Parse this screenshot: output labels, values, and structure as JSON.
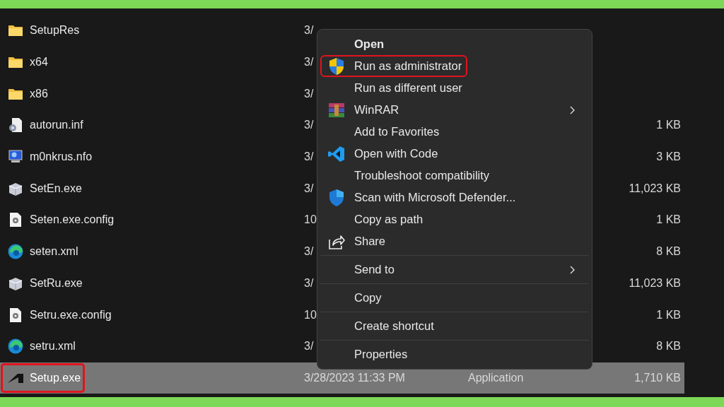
{
  "files": [
    {
      "name": "SetupRes",
      "kind": "folder",
      "date": "3/",
      "selected": false,
      "highlighted": false
    },
    {
      "name": "x64",
      "kind": "folder",
      "date": "3/",
      "selected": false,
      "highlighted": false
    },
    {
      "name": "x86",
      "kind": "folder",
      "date": "3/",
      "selected": false,
      "highlighted": false
    },
    {
      "name": "autorun.inf",
      "kind": "inf",
      "date": "3/",
      "size": "1 KB",
      "selected": false,
      "highlighted": false
    },
    {
      "name": "m0nkrus.nfo",
      "kind": "nfo",
      "date": "3/",
      "size": "3 KB",
      "selected": false,
      "highlighted": false
    },
    {
      "name": "SetEn.exe",
      "kind": "exe",
      "date": "3/",
      "size": "11,023 KB",
      "selected": false,
      "highlighted": false
    },
    {
      "name": "Seten.exe.config",
      "kind": "config",
      "date": "10",
      "size": "1 KB",
      "selected": false,
      "highlighted": false
    },
    {
      "name": "seten.xml",
      "kind": "xml",
      "date": "3/",
      "size": "8 KB",
      "selected": false,
      "highlighted": false
    },
    {
      "name": "SetRu.exe",
      "kind": "exe",
      "date": "3/",
      "size": "11,023 KB",
      "selected": false,
      "highlighted": false
    },
    {
      "name": "Setru.exe.config",
      "kind": "config",
      "date": "10",
      "size": "1 KB",
      "selected": false,
      "highlighted": false
    },
    {
      "name": "setru.xml",
      "kind": "xml",
      "date": "3/",
      "size": "8 KB",
      "selected": false,
      "highlighted": false
    },
    {
      "name": "Setup.exe",
      "kind": "app",
      "date": "3/28/2023 11:33 PM",
      "type": "Application",
      "size": "1,710 KB",
      "selected": true,
      "highlighted": true
    }
  ],
  "context_menu": {
    "groups": [
      [
        {
          "label": "Open",
          "kind": "plain",
          "default": true,
          "submenu": false,
          "highlighted": false
        },
        {
          "label": "Run as administrator",
          "kind": "uac",
          "default": false,
          "submenu": false,
          "highlighted": true
        },
        {
          "label": "Run as different user",
          "kind": "plain",
          "default": false,
          "submenu": false,
          "highlighted": false
        },
        {
          "label": "WinRAR",
          "kind": "archive",
          "default": false,
          "submenu": true,
          "highlighted": false
        },
        {
          "label": "Add to Favorites",
          "kind": "plain",
          "default": false,
          "submenu": false,
          "highlighted": false
        },
        {
          "label": "Open with Code",
          "kind": "code",
          "default": false,
          "submenu": false,
          "highlighted": false
        },
        {
          "label": "Troubleshoot compatibility",
          "kind": "plain",
          "default": false,
          "submenu": false,
          "highlighted": false
        },
        {
          "label": "Scan with Microsoft Defender...",
          "kind": "defender",
          "default": false,
          "submenu": false,
          "highlighted": false
        },
        {
          "label": "Copy as path",
          "kind": "plain",
          "default": false,
          "submenu": false,
          "highlighted": false
        },
        {
          "label": "Share",
          "kind": "share",
          "default": false,
          "submenu": false,
          "highlighted": false
        }
      ],
      [
        {
          "label": "Send to",
          "kind": "plain",
          "default": false,
          "submenu": true,
          "highlighted": false
        }
      ],
      [
        {
          "label": "Copy",
          "kind": "plain",
          "default": false,
          "submenu": false,
          "highlighted": false
        }
      ],
      [
        {
          "label": "Create shortcut",
          "kind": "plain",
          "default": false,
          "submenu": false,
          "highlighted": false
        }
      ],
      [
        {
          "label": "Properties",
          "kind": "plain",
          "default": false,
          "submenu": false,
          "highlighted": false
        }
      ]
    ]
  }
}
